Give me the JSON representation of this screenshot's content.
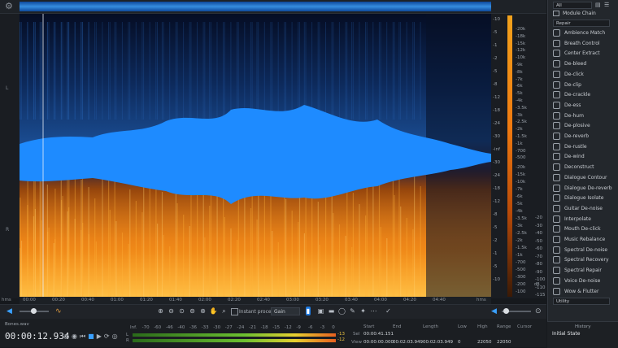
{
  "overview": {
    "gear_icon": "gear-icon"
  },
  "left_axis": {
    "channel_top": "L",
    "channel_bottom": "R"
  },
  "right_scale": {
    "db_top": [
      "-10",
      "-5",
      "-1",
      "-2",
      "-5",
      "-8",
      "-12",
      "-18",
      "-24",
      "-30",
      "-inf",
      "-30",
      "-24",
      "-18",
      "-12",
      "-8",
      "-5",
      "-2",
      "-1",
      "-5",
      "-10"
    ],
    "hz_top": [
      "-20k",
      "-18k",
      "-15k",
      "-12k",
      "-10k",
      "-9k",
      "-8k",
      "-7k",
      "-6k",
      "-5k",
      "-4k",
      "-3.5k",
      "-3k",
      "-2.5k",
      "-2k",
      "-1.5k",
      "-1k",
      "-700",
      "-500"
    ],
    "hz_bottom": [
      "-20k",
      "-15k",
      "-10k",
      "-7k",
      "-6k",
      "-5k",
      "-4k",
      "-3.5k",
      "-3k",
      "-2.5k",
      "-2k",
      "-1.5k",
      "-1k",
      "-700",
      "-500",
      "-300",
      "-200",
      "-100"
    ],
    "right_db": [
      "-20",
      "-30",
      "-40",
      "-50",
      "-60",
      "-70",
      "-80",
      "-90",
      "-100",
      "-110",
      "-115"
    ],
    "right_db_unit": "dB"
  },
  "ruler": {
    "labels": [
      "hms",
      "00:00",
      "00:20",
      "00:40",
      "01:00",
      "01:20",
      "01:40",
      "02:00",
      "02:20",
      "02:40",
      "03:00",
      "03:20",
      "03:40",
      "04:00",
      "04:20",
      "04:40",
      "hms"
    ]
  },
  "toolbar": {
    "instant_process": "Instant process",
    "gain": "Gain"
  },
  "bottom": {
    "filename": "Bones.wav",
    "timecode": "00:00:12.934",
    "meter_l": "L",
    "meter_r": "R",
    "meter_scale": [
      "Inf.",
      "-70",
      "-60",
      "-46",
      "-40",
      "-36",
      "-33",
      "-30",
      "-27",
      "-24",
      "-21",
      "-18",
      "-15",
      "-12",
      "-9",
      "-6",
      "-3",
      "0"
    ],
    "meter_val_l": "-13",
    "meter_val_r": "-12",
    "sel_label": "Sel",
    "view_label": "View",
    "headers": {
      "start": "Start",
      "end": "End",
      "length": "Length",
      "low": "Low",
      "high": "High",
      "range": "Range",
      "cursor": "Cursor"
    },
    "sel": {
      "start": "00:00:41.151",
      "end": "",
      "length": "",
      "low": "",
      "high": "",
      "range": ""
    },
    "view": {
      "start": "00:00:00.000",
      "end": "00:02:03.949",
      "length": "00:02:03.949",
      "low": "0",
      "high": "22050",
      "range": "22050"
    }
  },
  "panel": {
    "filter": "All",
    "module_chain": "Module Chain",
    "category": "Repair",
    "modules": [
      "Ambience Match",
      "Breath Control",
      "Center Extract",
      "De-bleed",
      "De-click",
      "De-clip",
      "De-crackle",
      "De-ess",
      "De-hum",
      "De-plosive",
      "De-reverb",
      "De-rustle",
      "De-wind",
      "Deconstruct",
      "Dialogue Contour",
      "Dialogue De-reverb",
      "Dialogue Isolate",
      "Guitar De-noise",
      "Interpolate",
      "Mouth De-click",
      "Music Rebalance",
      "Spectral De-noise",
      "Spectral Recovery",
      "Spectral Repair",
      "Voice De-noise",
      "Wow & Flutter"
    ],
    "utility": "Utility",
    "history": "History",
    "initial_state": "Initial State"
  }
}
